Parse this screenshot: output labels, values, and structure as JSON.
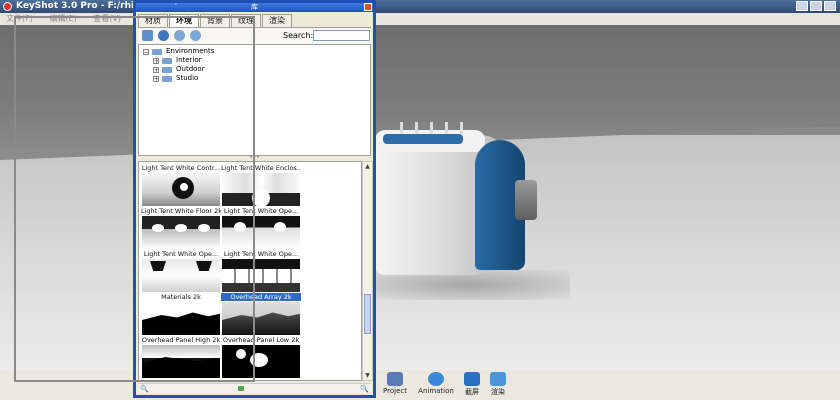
{
  "app": {
    "title": "KeyShot 3.0 Pro  -  F:/rhino课件/...",
    "menu": [
      "文件(F)",
      "编辑(E)",
      "查看(V)"
    ]
  },
  "library": {
    "title": "库",
    "tabs": [
      {
        "label": "材质",
        "active": false
      },
      {
        "label": "环境",
        "active": true
      },
      {
        "label": "背景",
        "active": false
      },
      {
        "label": "纹理",
        "active": false
      },
      {
        "label": "渲染",
        "active": false
      }
    ],
    "toolbar_icons": [
      "import-icon",
      "refresh-icon",
      "download-icon",
      "upload-icon"
    ],
    "search_label": "Search:",
    "search_value": "",
    "tree": {
      "root": "Environments",
      "children": [
        "Interior",
        "Outdoor",
        "Studio"
      ]
    },
    "thumbnails": [
      {
        "label": "Light Tent White Contr...",
        "selected": false,
        "style": "tent-contrast"
      },
      {
        "label": "Light Tent White Enclos...",
        "selected": false,
        "style": "tent-enclosed"
      },
      {
        "label": "Light Tent White Floor 2k",
        "selected": false,
        "style": "tent-floor"
      },
      {
        "label": "Light Tent White Ope...",
        "selected": false,
        "style": "tent-open1"
      },
      {
        "label": "Light Tent White Ope...",
        "selected": false,
        "style": "tent-open2"
      },
      {
        "label": "Light Tent White Ope...",
        "selected": false,
        "style": "tent-open3"
      },
      {
        "label": "Materials 2k",
        "selected": false,
        "style": "hills"
      },
      {
        "label": "Overhead Array 2k",
        "selected": true,
        "style": "hills-light"
      },
      {
        "label": "Overhead Panel High 2k",
        "selected": false,
        "style": "panel-high"
      },
      {
        "label": "Overhead Panel Low 2k",
        "selected": false,
        "style": "panel-low"
      }
    ]
  },
  "bottom_tools": [
    {
      "label": "Project",
      "icon": "project-icon"
    },
    {
      "label": "Animation",
      "icon": "animation-icon"
    },
    {
      "label": "截屏",
      "icon": "screenshot-icon"
    },
    {
      "label": "渲染",
      "icon": "render-icon"
    }
  ],
  "colors": {
    "panel_border": "#1f4fb7",
    "selection": "#316ac5",
    "product_accent": "#1f5a94"
  }
}
